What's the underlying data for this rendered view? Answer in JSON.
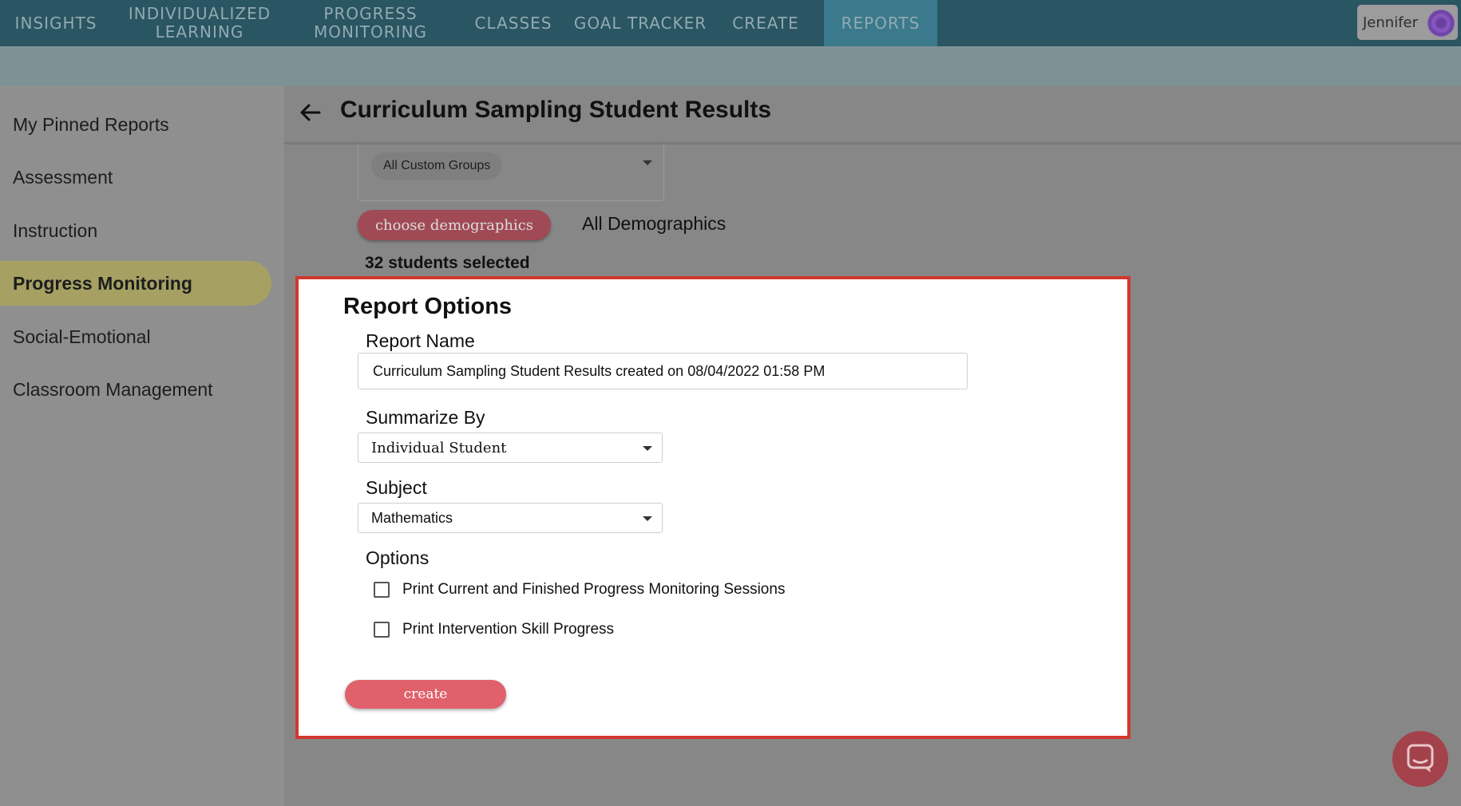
{
  "nav": {
    "items": [
      {
        "label": "INSIGHTS"
      },
      {
        "label": "INDIVIDUALIZED\nLEARNING"
      },
      {
        "label": "PROGRESS\nMONITORING"
      },
      {
        "label": "CLASSES"
      },
      {
        "label": "GOAL TRACKER"
      },
      {
        "label": "CREATE"
      },
      {
        "label": "REPORTS",
        "active": true
      }
    ],
    "user_name": "Jennifer"
  },
  "sidebar": {
    "items": [
      {
        "label": "My Pinned Reports"
      },
      {
        "label": "Assessment"
      },
      {
        "label": "Instruction"
      },
      {
        "label": "Progress Monitoring",
        "active": true
      },
      {
        "label": "Social-Emotional"
      },
      {
        "label": "Classroom Management"
      }
    ]
  },
  "header": {
    "title": "Curriculum Sampling Student Results"
  },
  "filters": {
    "groups_chip": "All Custom Groups",
    "demographics_button": "choose demographics",
    "demographics_value": "All Demographics",
    "students_selected": "32 students selected"
  },
  "report_options": {
    "title": "Report Options",
    "report_name_label": "Report Name",
    "report_name_value": "Curriculum Sampling Student Results created on 08/04/2022 01:58 PM",
    "summarize_label": "Summarize By",
    "summarize_value": "Individual Student",
    "subject_label": "Subject",
    "subject_value": "Mathematics",
    "options_label": "Options",
    "options": [
      {
        "label": "Print Current and Finished Progress Monitoring Sessions",
        "checked": false
      },
      {
        "label": "Print Intervention Skill Progress",
        "checked": false
      }
    ],
    "create_label": "create"
  },
  "colors": {
    "nav_bg": "#2a5562",
    "nav_active": "#3a7a8c",
    "sidebar_active": "#a6a063",
    "highlight_border": "#d2372e",
    "create_button": "#e0616b"
  }
}
